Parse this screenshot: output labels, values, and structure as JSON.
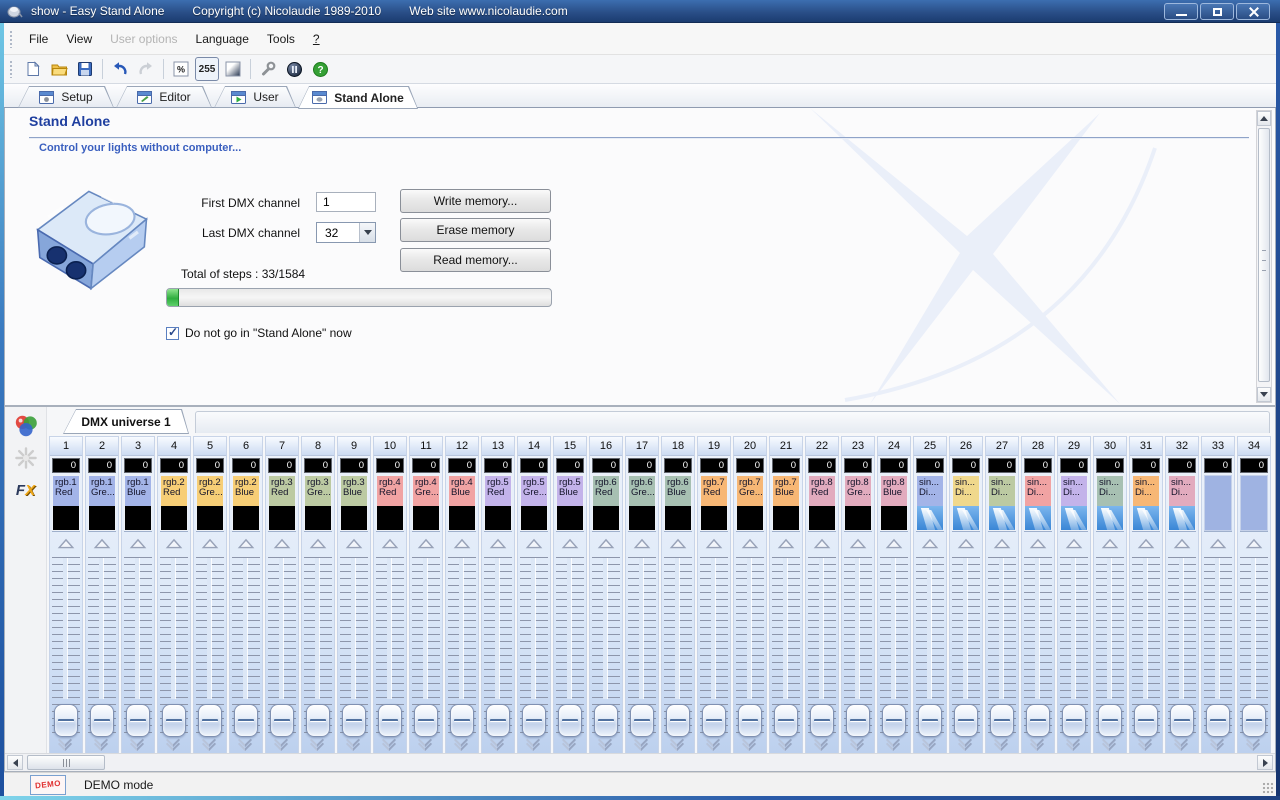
{
  "window": {
    "title_app": "show - Easy Stand Alone",
    "title_copyright": "Copyright (c) Nicolaudie 1989-2010",
    "title_website": "Web site www.nicolaudie.com",
    "buttons": [
      "minimize",
      "maximize",
      "close"
    ]
  },
  "menu": {
    "items": [
      {
        "label": "File",
        "enabled": true
      },
      {
        "label": "View",
        "enabled": true
      },
      {
        "label": "User options",
        "enabled": false
      },
      {
        "label": "Language",
        "enabled": true
      },
      {
        "label": "Tools",
        "enabled": true
      },
      {
        "label": "?",
        "enabled": true
      }
    ]
  },
  "toolbar": {
    "icons": [
      "new-document",
      "open-folder",
      "save",
      "undo",
      "redo-disabled",
      "percent-mode",
      "value-255-mode-pressed",
      "fade",
      "options-wrench",
      "dmx-sphere",
      "help"
    ],
    "percent_label": "%",
    "value255_label": "255"
  },
  "tabs": {
    "items": [
      {
        "label": "Setup",
        "active": false
      },
      {
        "label": "Editor",
        "active": false
      },
      {
        "label": "User",
        "active": false
      },
      {
        "label": "Stand Alone",
        "active": true
      }
    ]
  },
  "main": {
    "heading": "Stand Alone",
    "subtitle": "Control your lights without computer...",
    "first_dmx_label": "First DMX channel",
    "first_dmx_value": "1",
    "last_dmx_label": "Last DMX channel",
    "last_dmx_value": "32",
    "buttons": {
      "write": "Write memory...",
      "erase": "Erase memory",
      "read": "Read memory..."
    },
    "steps_label": "Total of steps : 33/1584",
    "progress_percent": 3,
    "checkbox_label": "Do not go in \"Stand Alone\" now",
    "checkbox_checked": true
  },
  "dmx": {
    "tab_label": "DMX universe 1",
    "sidebar_icons": [
      "color-circles",
      "starburst-disabled",
      "fx"
    ],
    "fx_f": "F",
    "fx_x": "X",
    "channels": [
      {
        "num": 1,
        "value": 0,
        "label1": "rgb.1",
        "label2": "Red",
        "color": "#a3b4e8",
        "body": "black"
      },
      {
        "num": 2,
        "value": 0,
        "label1": "rgb.1",
        "label2": "Gre...",
        "color": "#a3b4e8",
        "body": "black"
      },
      {
        "num": 3,
        "value": 0,
        "label1": "rgb.1",
        "label2": "Blue",
        "color": "#a3b4e8",
        "body": "black"
      },
      {
        "num": 4,
        "value": 0,
        "label1": "rgb.2",
        "label2": "Red",
        "color": "#f7ce76",
        "body": "black"
      },
      {
        "num": 5,
        "value": 0,
        "label1": "rgb.2",
        "label2": "Gre...",
        "color": "#f7ce76",
        "body": "black"
      },
      {
        "num": 6,
        "value": 0,
        "label1": "rgb.2",
        "label2": "Blue",
        "color": "#f7ce76",
        "body": "black"
      },
      {
        "num": 7,
        "value": 0,
        "label1": "rgb.3",
        "label2": "Red",
        "color": "#bccaa2",
        "body": "black"
      },
      {
        "num": 8,
        "value": 0,
        "label1": "rgb.3",
        "label2": "Gre...",
        "color": "#bccaa2",
        "body": "black"
      },
      {
        "num": 9,
        "value": 0,
        "label1": "rgb.3",
        "label2": "Blue",
        "color": "#bccaa2",
        "body": "black"
      },
      {
        "num": 10,
        "value": 0,
        "label1": "rgb.4",
        "label2": "Red",
        "color": "#f1a3a3",
        "body": "black"
      },
      {
        "num": 11,
        "value": 0,
        "label1": "rgb.4",
        "label2": "Gre...",
        "color": "#f1a3a3",
        "body": "black"
      },
      {
        "num": 12,
        "value": 0,
        "label1": "rgb.4",
        "label2": "Blue",
        "color": "#f1a3a3",
        "body": "black"
      },
      {
        "num": 13,
        "value": 0,
        "label1": "rgb.5",
        "label2": "Red",
        "color": "#c3b3ea",
        "body": "black"
      },
      {
        "num": 14,
        "value": 0,
        "label1": "rgb.5",
        "label2": "Gre...",
        "color": "#c3b3ea",
        "body": "black"
      },
      {
        "num": 15,
        "value": 0,
        "label1": "rgb.5",
        "label2": "Blue",
        "color": "#c3b3ea",
        "body": "black"
      },
      {
        "num": 16,
        "value": 0,
        "label1": "rgb.6",
        "label2": "Red",
        "color": "#a7c0b2",
        "body": "black"
      },
      {
        "num": 17,
        "value": 0,
        "label1": "rgb.6",
        "label2": "Gre...",
        "color": "#a7c0b2",
        "body": "black"
      },
      {
        "num": 18,
        "value": 0,
        "label1": "rgb.6",
        "label2": "Blue",
        "color": "#a7c0b2",
        "body": "black"
      },
      {
        "num": 19,
        "value": 0,
        "label1": "rgb.7",
        "label2": "Red",
        "color": "#f7b775",
        "body": "black"
      },
      {
        "num": 20,
        "value": 0,
        "label1": "rgb.7",
        "label2": "Gre...",
        "color": "#f7b775",
        "body": "black"
      },
      {
        "num": 21,
        "value": 0,
        "label1": "rgb.7",
        "label2": "Blue",
        "color": "#f7b775",
        "body": "black"
      },
      {
        "num": 22,
        "value": 0,
        "label1": "rgb.8",
        "label2": "Red",
        "color": "#e2abbe",
        "body": "black"
      },
      {
        "num": 23,
        "value": 0,
        "label1": "rgb.8",
        "label2": "Gre...",
        "color": "#e2abbe",
        "body": "black"
      },
      {
        "num": 24,
        "value": 0,
        "label1": "rgb.8",
        "label2": "Blue",
        "color": "#e2abbe",
        "body": "black"
      },
      {
        "num": 25,
        "value": 0,
        "label1": "sin...",
        "label2": "Di...",
        "color": "#a3b4e8",
        "body": "beam"
      },
      {
        "num": 26,
        "value": 0,
        "label1": "sin...",
        "label2": "Di...",
        "color": "#f0d88c",
        "body": "beam"
      },
      {
        "num": 27,
        "value": 0,
        "label1": "sin...",
        "label2": "Di...",
        "color": "#bccaa2",
        "body": "beam"
      },
      {
        "num": 28,
        "value": 0,
        "label1": "sin...",
        "label2": "Di...",
        "color": "#f1a3a3",
        "body": "beam"
      },
      {
        "num": 29,
        "value": 0,
        "label1": "sin...",
        "label2": "Di...",
        "color": "#c3b3ea",
        "body": "beam"
      },
      {
        "num": 30,
        "value": 0,
        "label1": "sin...",
        "label2": "Di...",
        "color": "#a7c0b2",
        "body": "beam"
      },
      {
        "num": 31,
        "value": 0,
        "label1": "sin...",
        "label2": "Di...",
        "color": "#f7b775",
        "body": "beam"
      },
      {
        "num": 32,
        "value": 0,
        "label1": "sin...",
        "label2": "Di...",
        "color": "#e2abbe",
        "body": "beam"
      },
      {
        "num": 33,
        "value": 0,
        "label1": "",
        "label2": "",
        "color": "#9fb3e2",
        "body": "plain"
      },
      {
        "num": 34,
        "value": 0,
        "label1": "",
        "label2": "",
        "color": "#9fb3e2",
        "body": "plain"
      }
    ]
  },
  "statusbar": {
    "demo_badge": "DEMO",
    "text": "DEMO mode"
  },
  "colors": {
    "titlebar_blue": "#2a4f88",
    "heading_blue": "#1f3f9f",
    "subtitle_blue": "#3a5fbf",
    "progress_green": "#2fae3f",
    "strip_blue": "#dce8f8"
  }
}
